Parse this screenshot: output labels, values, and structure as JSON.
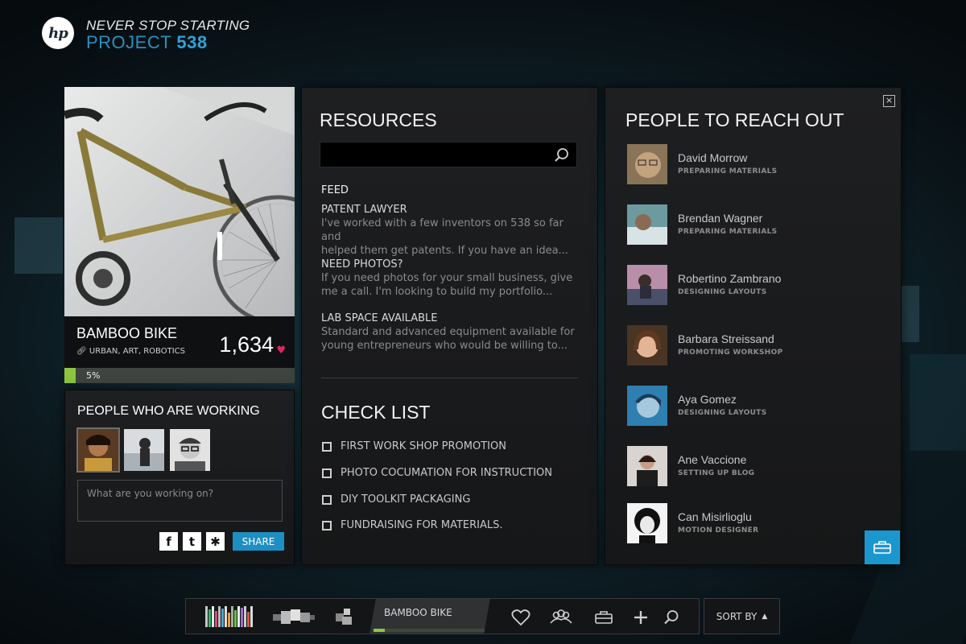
{
  "header": {
    "tagline": "NEVER STOP STARTING",
    "project_label": "PROJECT",
    "project_number": "538",
    "logo_text": "hp"
  },
  "project_card": {
    "title": "BAMBOO BIKE",
    "tags": "URBAN, ART, ROBOTICS",
    "likes": "1,634",
    "progress_label": "5%",
    "progress": 0.05
  },
  "working": {
    "title": "PEOPLE WHO ARE WORKING",
    "input_placeholder": "What are you working on?",
    "share_label": "SHARE",
    "social": [
      "facebook-icon",
      "twitter-icon",
      "myspace-icon"
    ]
  },
  "resources": {
    "title": "RESOURCES",
    "feed_label": "FEED",
    "feed": [
      {
        "title": "PATENT LAWYER",
        "line1": "I've worked with a few inventors on 538 so far and",
        "line2": "helped them get patents. If you have an idea..."
      },
      {
        "title": "NEED PHOTOS?",
        "line1": "If you need photos for your small business, give",
        "line2": "me a call. I'm looking to build my portfolio..."
      },
      {
        "title": "LAB SPACE AVAILABLE",
        "line1": "Standard and advanced equipment available for",
        "line2": "young entrepreneurs who would be willing to..."
      }
    ],
    "checklist_title": "CHECK LIST",
    "checklist": [
      "FIRST WORK SHOP PROMOTION",
      "PHOTO COCUMATION FOR INSTRUCTION",
      "DIY TOOLKIT PACKAGING",
      "FUNDRAISING FOR MATERIALS."
    ]
  },
  "people": {
    "title": "PEOPLE TO REACH OUT",
    "close_label": "×",
    "list": [
      {
        "name": "David Morrow",
        "status": "PREPARING MATERIALS"
      },
      {
        "name": "Brendan Wagner",
        "status": "PREPARING MATERIALS"
      },
      {
        "name": "Robertino Zambrano",
        "status": "DESIGNING LAYOUTS"
      },
      {
        "name": "Barbara Streissand",
        "status": "PROMOTING WORKSHOP"
      },
      {
        "name": "Aya Gomez",
        "status": "DESIGNING LAYOUTS"
      },
      {
        "name": "Ane Vaccione",
        "status": "SETTING UP BLOG"
      },
      {
        "name": "Can Misirlioglu",
        "status": "MOTION DESIGNER"
      }
    ]
  },
  "toolbar": {
    "active_project": "BAMBOO BIKE",
    "sort_label": "SORT BY",
    "icons": [
      "heart-icon",
      "group-icon",
      "toolbox-icon",
      "plus-icon",
      "search-icon"
    ]
  },
  "colors": {
    "accent_blue": "#1d8fc2",
    "progress_green": "#8cc63e",
    "heart_pink": "#e0245e"
  }
}
